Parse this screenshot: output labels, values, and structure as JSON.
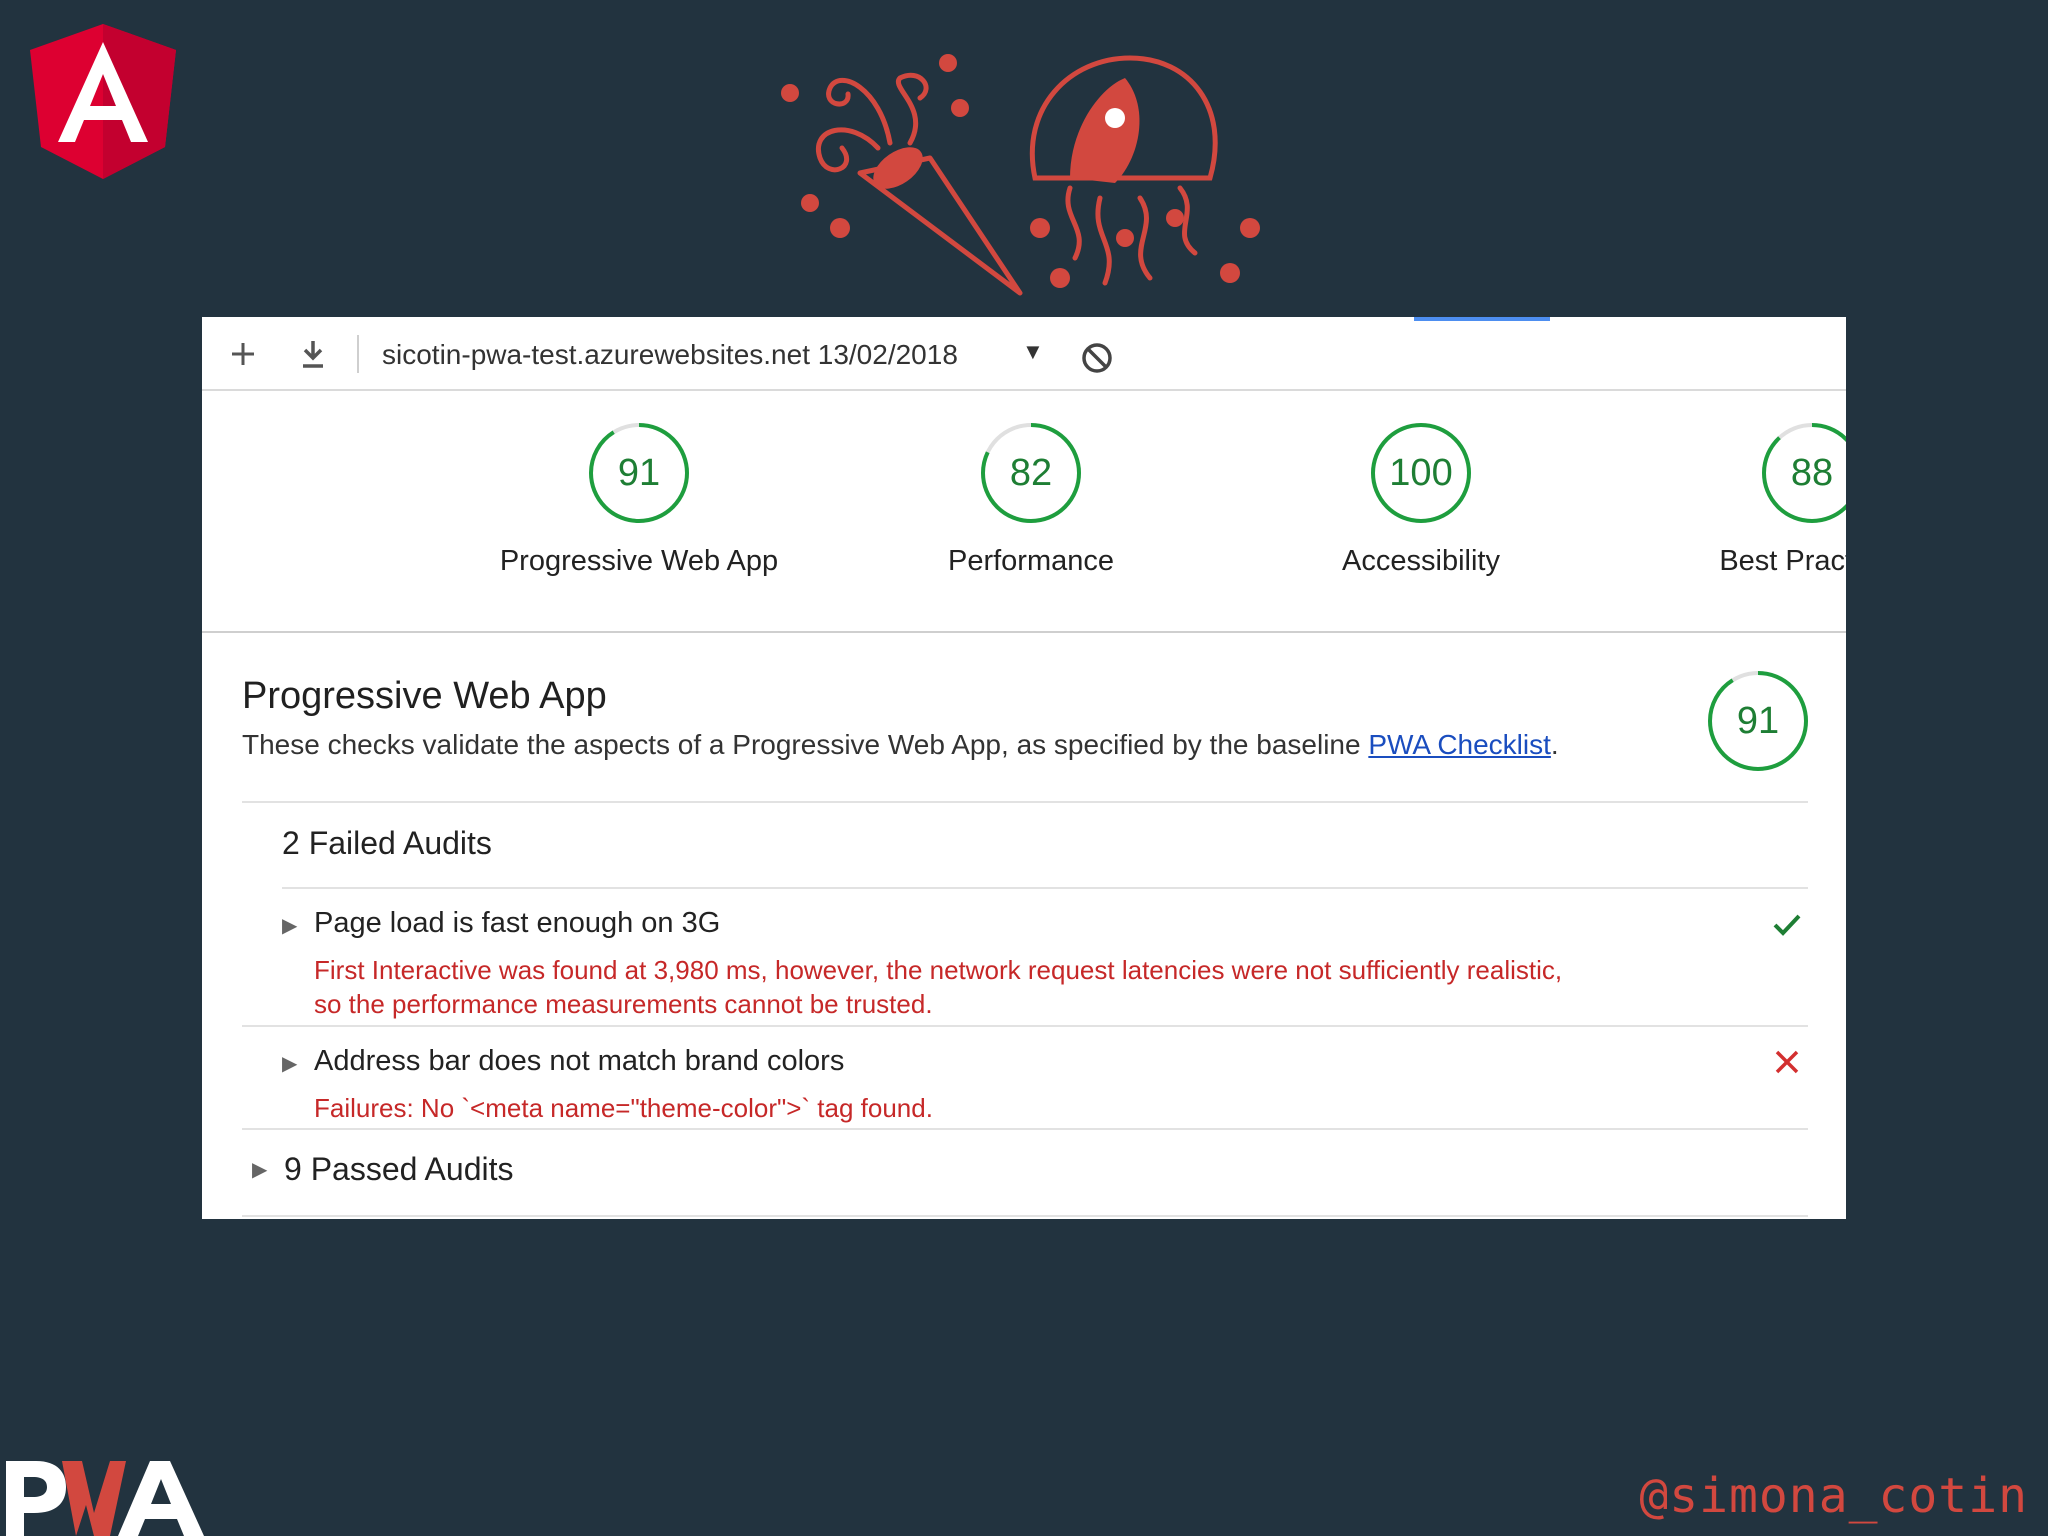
{
  "toolbar": {
    "add_icon": "plus-icon",
    "download_icon": "download-icon",
    "report_selector": "sicotin-pwa-test.azurewebsites.net 13/02/2018",
    "dropdown_caret": "▼",
    "clear_icon": "block-icon"
  },
  "scores": [
    {
      "value": "91",
      "label": "Progressive Web App",
      "fraction": 0.91
    },
    {
      "value": "82",
      "label": "Performance",
      "fraction": 0.82
    },
    {
      "value": "100",
      "label": "Accessibility",
      "fraction": 1.0
    },
    {
      "value": "88",
      "label": "Best Practices",
      "fraction": 0.88
    }
  ],
  "section": {
    "title": "Progressive Web App",
    "description": "These checks validate the aspects of a Progressive Web App, as specified by the baseline ",
    "link_text": "PWA Checklist",
    "description_end": ".",
    "score": "91",
    "score_fraction": 0.91
  },
  "failed_heading": "2 Failed Audits",
  "audits": [
    {
      "title": "Page load is fast enough on 3G",
      "message_line1": "First Interactive was found at 3,980 ms, however, the network request latencies were not sufficiently realistic,",
      "message_line2": "so the performance measurements cannot be trusted.",
      "status": "check-icon"
    },
    {
      "title": "Address bar does not match brand colors",
      "message_line1": "Failures: No `<meta name=\"theme-color\">` tag found.",
      "status": "cross-icon"
    }
  ],
  "passed_label": "9 Passed Audits",
  "angular_logo_letter": "A",
  "pwa_logo_text": "PWA",
  "handle": "@simona_cotin",
  "colors": {
    "background": "#22333f",
    "accent_red": "#d2483f",
    "pass_green": "#1e7e34",
    "fail_red": "#c62828",
    "link_blue": "#1a4dbf"
  }
}
